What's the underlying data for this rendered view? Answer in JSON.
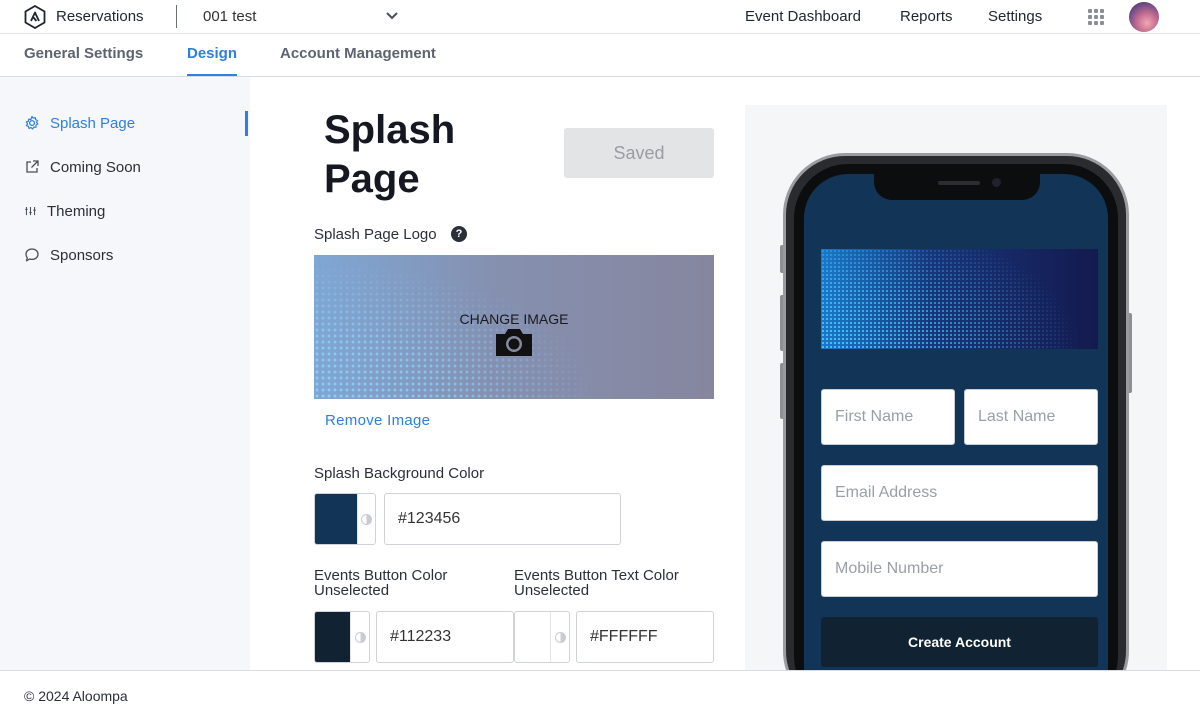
{
  "header": {
    "app_name": "Reservations",
    "event_selected": "001 test",
    "nav": [
      "Event Dashboard",
      "Reports",
      "Settings"
    ]
  },
  "tabs": [
    "General Settings",
    "Design",
    "Account Management"
  ],
  "active_tab": "Design",
  "sidebar": {
    "items": [
      {
        "label": "Splash Page",
        "icon": "gear-icon",
        "active": true
      },
      {
        "label": "Coming Soon",
        "icon": "external-link-icon"
      },
      {
        "label": "Theming",
        "icon": "sliders-icon"
      },
      {
        "label": "Sponsors",
        "icon": "chat-bubble-icon"
      }
    ]
  },
  "editor": {
    "title": "Splash Page",
    "save_label": "Saved",
    "logo_label": "Splash Page Logo",
    "change_image": "CHANGE IMAGE",
    "remove_image": "Remove Image",
    "bg_color_label": "Splash Background Color",
    "bg_color_value": "#123456",
    "events_btn_color_label": "Events Button Color Unselected",
    "events_btn_color_value": "#112233",
    "events_btn_text_label": "Events Button Text Color Unselected",
    "events_btn_text_value": "#FFFFFF"
  },
  "preview": {
    "first_name_placeholder": "First Name",
    "last_name_placeholder": "Last Name",
    "email_placeholder": "Email Address",
    "mobile_placeholder": "Mobile Number",
    "create_account": "Create Account"
  },
  "colors": {
    "accent": "#2d7fe0",
    "splash_background": "#123456",
    "events_button": "#112233",
    "events_button_text": "#FFFFFF"
  },
  "footer": {
    "copyright": "© 2024 Aloompa"
  }
}
